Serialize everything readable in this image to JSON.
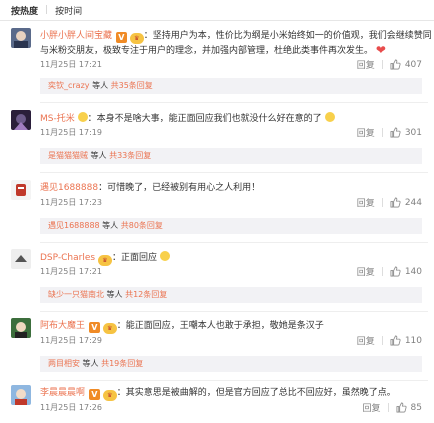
{
  "sort": {
    "hot": "按热度",
    "time": "按时间"
  },
  "comments": [
    {
      "user": "小胖小胖人间宝藏",
      "text_line1": "：坚持用户为本，性价比为纲是小米始终如一的价值观，我们会继续赞同",
      "text_line2": "与米粉交朋友，极致专注于用户的理念，并加强内部管理，杜绝此类事件再次发生。",
      "time": "11月25日 17:21",
      "reply": "回复",
      "likes": "407",
      "sub_user": "奕钦_crazy",
      "sub_mid": " 等人 ",
      "sub_more": "共35条回复"
    },
    {
      "user": "MS-托米",
      "text_line1": "：本身不是啥大事，能正面回应我们也就没什么好在意的了",
      "time": "11月25日 17:19",
      "reply": "回复",
      "likes": "301",
      "sub_user": "是猫猫猫贼",
      "sub_mid": " 等人 ",
      "sub_more": "共33条回复"
    },
    {
      "user": "遇见1688888",
      "text_line1": "：可惜晚了，已经被别有用心之人利用！",
      "time": "11月25日 17:23",
      "reply": "回复",
      "likes": "244",
      "sub_user": "遇见1688888",
      "sub_mid": " 等人 ",
      "sub_more": "共80条回复"
    },
    {
      "user": "DSP-Charles",
      "text_line1": "：正面回应",
      "time": "11月25日 17:21",
      "reply": "回复",
      "likes": "140",
      "sub_user": "缺少一只猫南北",
      "sub_mid": " 等人 ",
      "sub_more": "共12条回复"
    },
    {
      "user": "阿布大魔王",
      "text_line1": "：能正面回应，王嘲本人也敢于承担，敬她是条汉子",
      "time": "11月25日 17:29",
      "reply": "回复",
      "likes": "110",
      "sub_user": "两目相安",
      "sub_mid": " 等人 ",
      "sub_more": "共19条回复"
    },
    {
      "user": "李晨晨晨啊",
      "text_line1": "：其实意思是被曲解的，但是官方回应了总比不回应好，虽然晚了点。",
      "time": "11月25日 17:26",
      "reply": "回复",
      "likes": "85"
    }
  ],
  "colors": {
    "username": "#eb7350",
    "badge": "#f08b26",
    "time": "#808080",
    "replybox": "#f2f2f5"
  }
}
